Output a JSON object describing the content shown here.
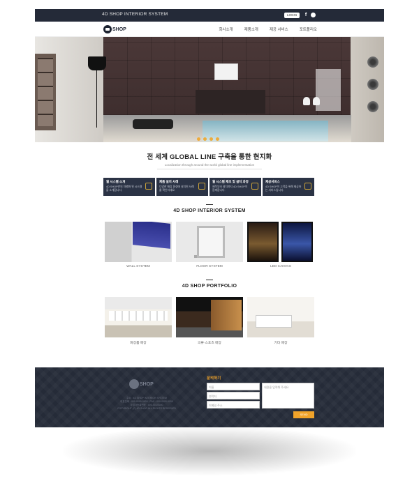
{
  "topbar": {
    "brand": "4D SHOP INTERIOR SYSTEM",
    "login_label": "LOGIN",
    "facebook_label": "f"
  },
  "nav": {
    "logo_text": "SHOP",
    "menu": [
      "회사소개",
      "제품소개",
      "제공 서비스",
      "포트폴리오"
    ]
  },
  "hero": {
    "slide_count": 4,
    "accent_color": "#f1a62b"
  },
  "headline": {
    "title": "전 세계 GLOBAL LINE 구축을 통한 현지화",
    "subtitle": "Localization through around the world global line implementation"
  },
  "info_boxes": [
    {
      "title": "월 시스템 소개",
      "desc": "4D SHOP만의 차별화 된 시스템을 소개합니다."
    },
    {
      "title": "제품 설치 사례",
      "desc": "다양한 매장 환경에 설치된 사례를 확인하세요."
    },
    {
      "title": "월 시스템 제조 및 설치 과정",
      "desc": "제작부터 설치까지 4D SHOP이 함께합니다."
    },
    {
      "title": "제공서비스",
      "desc": "4D SHOP이 고객을 위해 제공하는 서비스입니다."
    }
  ],
  "sections": {
    "system_title": "4D SHOP INTERIOR SYSTEM",
    "portfolio_title": "4D SHOP PORTFOLIO"
  },
  "system_items": [
    {
      "caption": "WALL SYSTEM"
    },
    {
      "caption": "FLOOR SYSTEM"
    },
    {
      "caption": "LED CANVAS"
    }
  ],
  "portfolio_items": [
    {
      "caption": "화장품 매장"
    },
    {
      "caption": "의류·스포츠 매장"
    },
    {
      "caption": "기타 매장"
    }
  ],
  "footer": {
    "logo_text": "SHOP",
    "info_lines": [
      "주소 : 4D SHOP INTERIOR SYSTEM",
      "대표전화 : 000-0000-0000 | FAX : 000-0000-0000",
      "사업자등록번호 : 000-00-00000",
      "COPYRIGHT (C) 4D SHOP ALL RIGHTS RESERVED"
    ],
    "form_title": "문의하기",
    "name_placeholder": "이름",
    "phone_placeholder": "연락처",
    "email_placeholder": "이메일 주소",
    "message_placeholder": "내용을 입력해 주세요",
    "send_label": "SEND",
    "accent_color": "#f0a32a"
  }
}
